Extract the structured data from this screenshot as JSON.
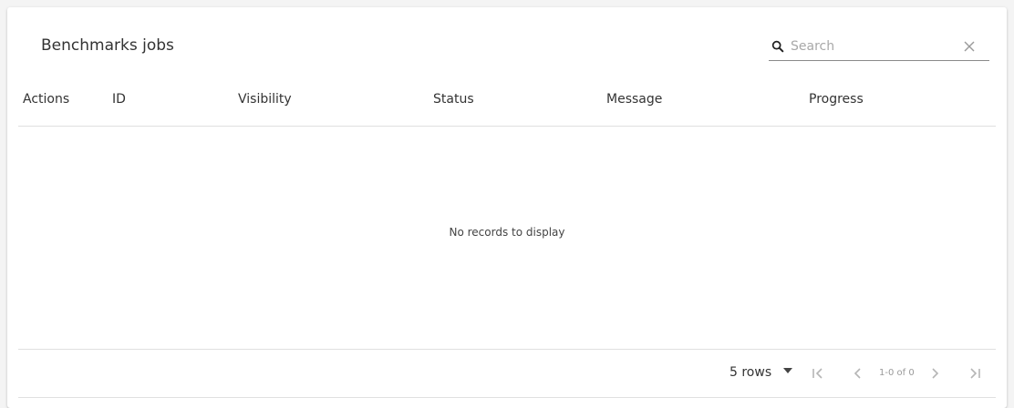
{
  "header": {
    "title": "Benchmarks jobs"
  },
  "search": {
    "placeholder": "Search",
    "value": ""
  },
  "table": {
    "columns": [
      "Actions",
      "ID",
      "Visibility",
      "Status",
      "Message",
      "Progress"
    ],
    "rows": [],
    "empty_message": "No records to display"
  },
  "pagination": {
    "rows_per_page": "5 rows",
    "page_info": "1-0 of 0"
  },
  "icons": {
    "search": "search-icon",
    "clear": "close-icon",
    "caret": "caret-down-icon",
    "first": "first-page-icon",
    "prev": "chevron-left-icon",
    "next": "chevron-right-icon",
    "last": "last-page-icon"
  },
  "colors": {
    "divider": "#e0e0e0",
    "muted": "#9a9a9a",
    "text": "#333333"
  }
}
